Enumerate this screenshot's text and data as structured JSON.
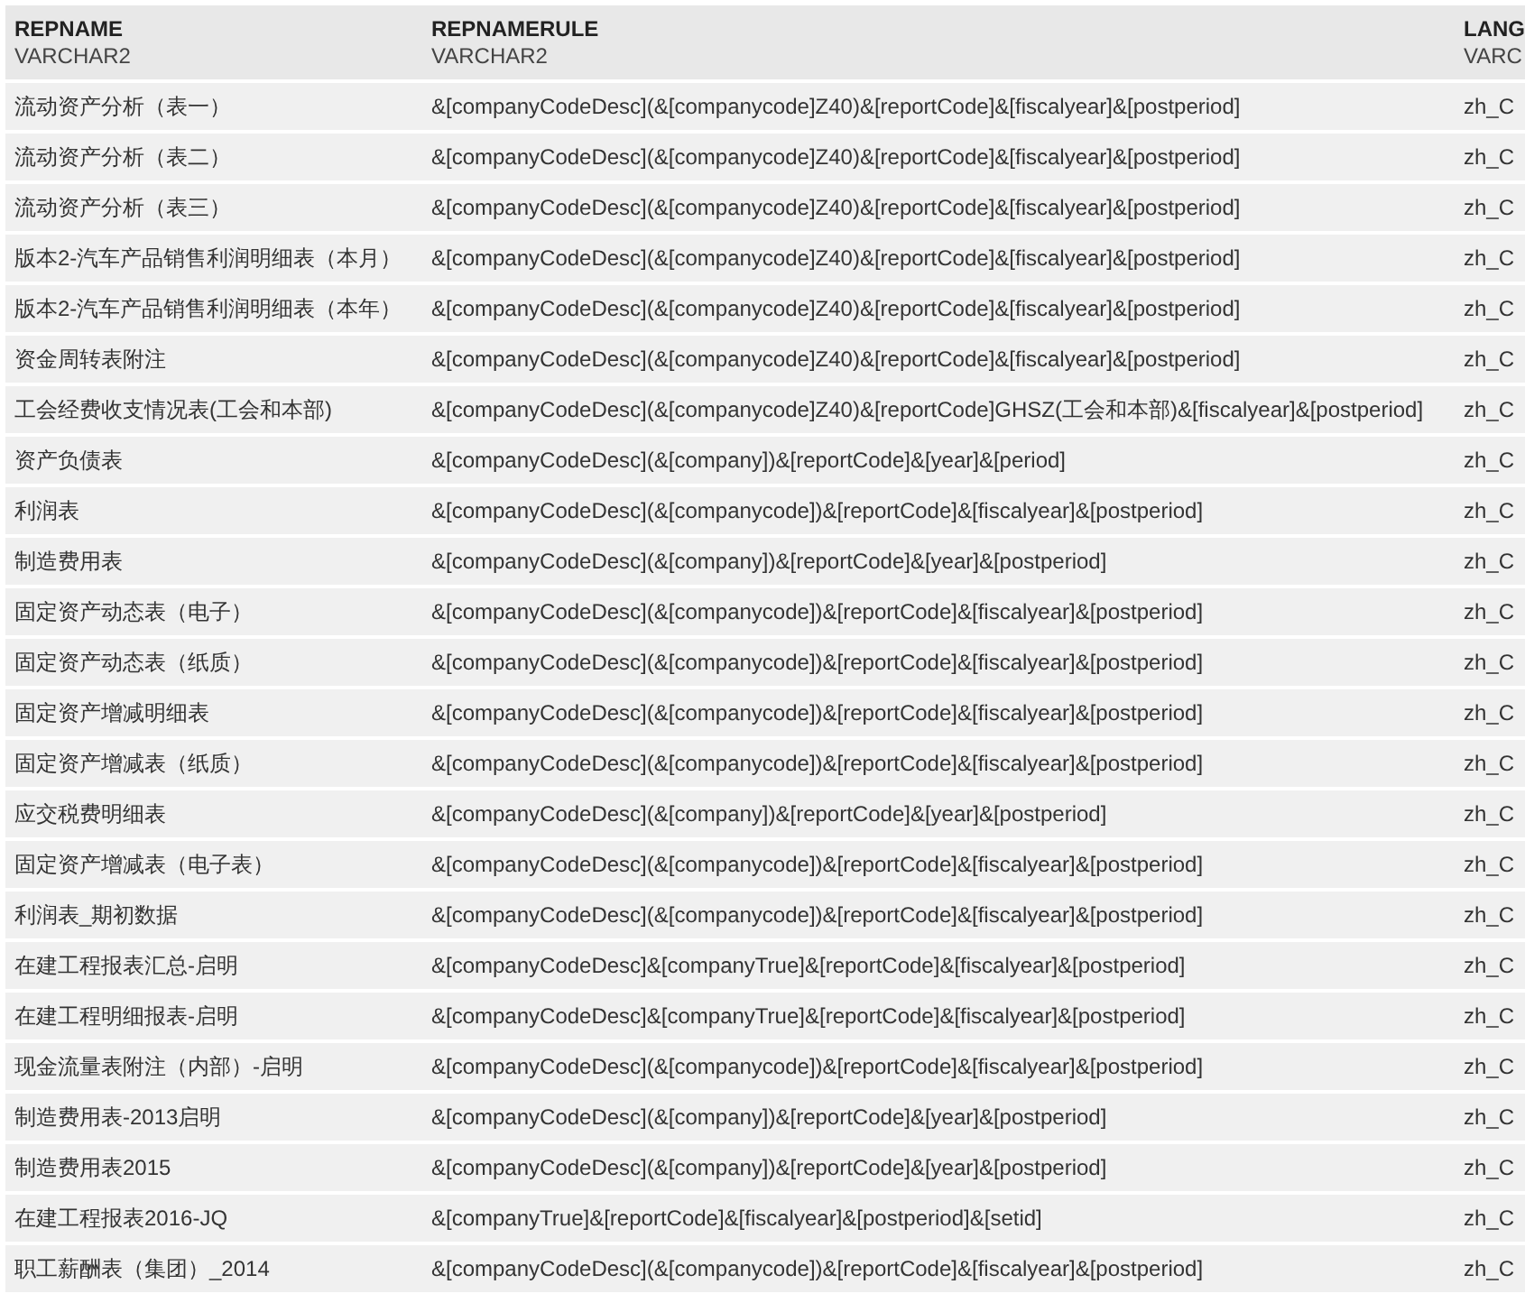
{
  "table": {
    "columns": [
      {
        "name": "REPNAME",
        "type": "VARCHAR2"
      },
      {
        "name": "REPNAMERULE",
        "type": "VARCHAR2"
      },
      {
        "name": "LANG",
        "type": "VARC"
      }
    ],
    "rows": [
      [
        "流动资产分析（表一）",
        "&[companyCodeDesc](&[companycode]Z40)&[reportCode]&[fiscalyear]&[postperiod]",
        "zh_C"
      ],
      [
        "流动资产分析（表二）",
        "&[companyCodeDesc](&[companycode]Z40)&[reportCode]&[fiscalyear]&[postperiod]",
        "zh_C"
      ],
      [
        "流动资产分析（表三）",
        "&[companyCodeDesc](&[companycode]Z40)&[reportCode]&[fiscalyear]&[postperiod]",
        "zh_C"
      ],
      [
        "版本2-汽车产品销售利润明细表（本月）",
        "&[companyCodeDesc](&[companycode]Z40)&[reportCode]&[fiscalyear]&[postperiod]",
        "zh_C"
      ],
      [
        "版本2-汽车产品销售利润明细表（本年）",
        "&[companyCodeDesc](&[companycode]Z40)&[reportCode]&[fiscalyear]&[postperiod]",
        "zh_C"
      ],
      [
        "资金周转表附注",
        "&[companyCodeDesc](&[companycode]Z40)&[reportCode]&[fiscalyear]&[postperiod]",
        "zh_C"
      ],
      [
        "工会经费收支情况表(工会和本部)",
        "&[companyCodeDesc](&[companycode]Z40)&[reportCode]GHSZ(工会和本部)&[fiscalyear]&[postperiod]",
        "zh_C"
      ],
      [
        "资产负债表",
        "&[companyCodeDesc](&[company])&[reportCode]&[year]&[period]",
        "zh_C"
      ],
      [
        "利润表",
        "&[companyCodeDesc](&[companycode])&[reportCode]&[fiscalyear]&[postperiod]",
        "zh_C"
      ],
      [
        "制造费用表",
        "&[companyCodeDesc](&[company])&[reportCode]&[year]&[postperiod]",
        "zh_C"
      ],
      [
        "固定资产动态表（电子）",
        "&[companyCodeDesc](&[companycode])&[reportCode]&[fiscalyear]&[postperiod]",
        "zh_C"
      ],
      [
        "固定资产动态表（纸质）",
        "&[companyCodeDesc](&[companycode])&[reportCode]&[fiscalyear]&[postperiod]",
        "zh_C"
      ],
      [
        "固定资产增减明细表",
        "&[companyCodeDesc](&[companycode])&[reportCode]&[fiscalyear]&[postperiod]",
        "zh_C"
      ],
      [
        "固定资产增减表（纸质）",
        "&[companyCodeDesc](&[companycode])&[reportCode]&[fiscalyear]&[postperiod]",
        "zh_C"
      ],
      [
        "应交税费明细表",
        "&[companyCodeDesc](&[company])&[reportCode]&[year]&[postperiod]",
        "zh_C"
      ],
      [
        "固定资产增减表（电子表）",
        "&[companyCodeDesc](&[companycode])&[reportCode]&[fiscalyear]&[postperiod]",
        "zh_C"
      ],
      [
        "利润表_期初数据",
        "&[companyCodeDesc](&[companycode])&[reportCode]&[fiscalyear]&[postperiod]",
        "zh_C"
      ],
      [
        "在建工程报表汇总-启明",
        "&[companyCodeDesc]&[companyTrue]&[reportCode]&[fiscalyear]&[postperiod]",
        "zh_C"
      ],
      [
        "在建工程明细报表-启明",
        "&[companyCodeDesc]&[companyTrue]&[reportCode]&[fiscalyear]&[postperiod]",
        "zh_C"
      ],
      [
        "现金流量表附注（内部）-启明",
        "&[companyCodeDesc](&[companycode])&[reportCode]&[fiscalyear]&[postperiod]",
        "zh_C"
      ],
      [
        "制造费用表-2013启明",
        "&[companyCodeDesc](&[company])&[reportCode]&[year]&[postperiod]",
        "zh_C"
      ],
      [
        "制造费用表2015",
        "&[companyCodeDesc](&[company])&[reportCode]&[year]&[postperiod]",
        "zh_C"
      ],
      [
        "在建工程报表2016-JQ",
        "&[companyTrue]&[reportCode]&[fiscalyear]&[postperiod]&[setid]",
        "zh_C"
      ],
      [
        "职工薪酬表（集团）_2014",
        "&[companyCodeDesc](&[companycode])&[reportCode]&[fiscalyear]&[postperiod]",
        "zh_C"
      ]
    ]
  }
}
